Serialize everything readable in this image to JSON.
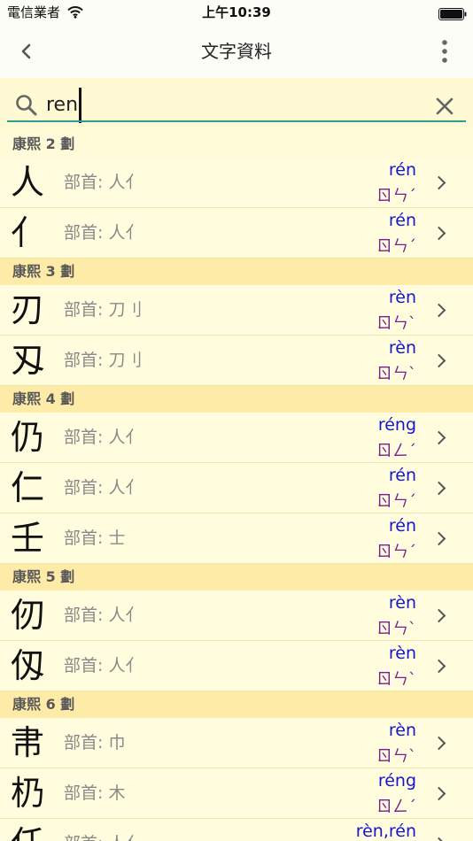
{
  "status_bar": {
    "carrier": "電信業者",
    "time": "上午10:39",
    "wifi_icon": "wifi-icon",
    "battery_icon": "battery-icon"
  },
  "nav": {
    "title": "文字資料",
    "back_icon": "chevron-left-icon",
    "menu_icon": "more-vertical-icon"
  },
  "search": {
    "query": "ren",
    "search_icon": "search-icon",
    "clear_icon": "close-icon"
  },
  "colors": {
    "list_background": "#FFFDDE",
    "section_header_background": "#FFEBA8",
    "search_background": "#FFFAD4",
    "accent": "#2A9D8F",
    "pinyin": "#1515D0",
    "zhuyin": "#7A1E8C"
  },
  "sections": [
    {
      "header": "康熙 2 劃",
      "rows": [
        {
          "char": "人",
          "radical": "部首: 人亻",
          "pinyin": "rén",
          "zhuyin": "ㄖㄣˊ"
        },
        {
          "char": "亻",
          "radical": "部首: 人亻",
          "pinyin": "rén",
          "zhuyin": "ㄖㄣˊ"
        }
      ]
    },
    {
      "header": "康熙 3 劃",
      "rows": [
        {
          "char": "刃",
          "radical": "部首: 刀刂",
          "pinyin": "rèn",
          "zhuyin": "ㄖㄣˋ"
        },
        {
          "char": "刄",
          "radical": "部首: 刀刂",
          "pinyin": "rèn",
          "zhuyin": "ㄖㄣˋ"
        }
      ]
    },
    {
      "header": "康熙 4 劃",
      "rows": [
        {
          "char": "仍",
          "radical": "部首: 人亻",
          "pinyin": "réng",
          "zhuyin": "ㄖㄥˊ"
        },
        {
          "char": "仁",
          "radical": "部首: 人亻",
          "pinyin": "rén",
          "zhuyin": "ㄖㄣˊ"
        },
        {
          "char": "壬",
          "radical": "部首: 士",
          "pinyin": "rén",
          "zhuyin": "ㄖㄣˊ"
        }
      ]
    },
    {
      "header": "康熙 5 劃",
      "rows": [
        {
          "char": "仞",
          "radical": "部首: 人亻",
          "pinyin": "rèn",
          "zhuyin": "ㄖㄣˋ"
        },
        {
          "char": "仭",
          "radical": "部首: 人亻",
          "pinyin": "rèn",
          "zhuyin": "ㄖㄣˋ"
        }
      ]
    },
    {
      "header": "康熙 6 劃",
      "rows": [
        {
          "char": "帇",
          "radical": "部首: 巾",
          "pinyin": "rèn",
          "zhuyin": "ㄖㄣˋ"
        },
        {
          "char": "㭁",
          "radical": "部首: 木",
          "pinyin": "réng",
          "zhuyin": "ㄖㄥˊ"
        },
        {
          "char": "任",
          "radical": "部首: 人亻",
          "pinyin": "rèn,rén"
        }
      ]
    }
  ]
}
